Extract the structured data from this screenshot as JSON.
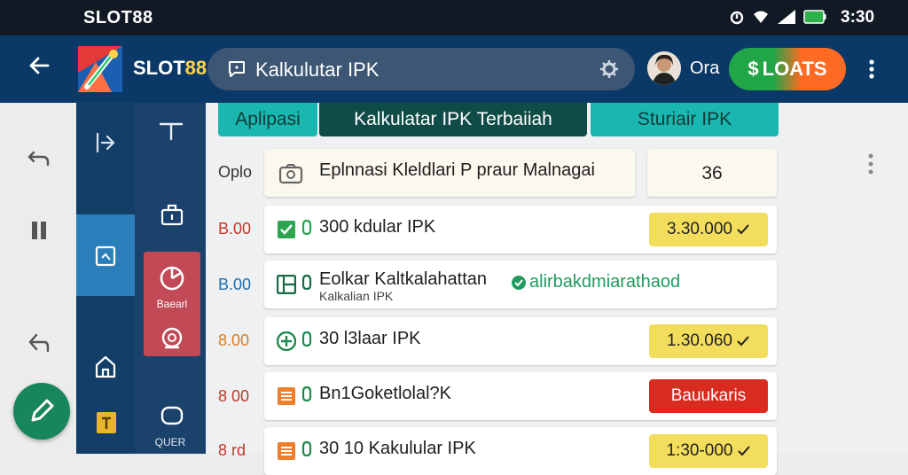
{
  "status_bar": {
    "brand": "SLOT88",
    "time": "3:30",
    "icons": [
      "alarm-icon",
      "wifi-icon",
      "signal-icon",
      "battery-icon"
    ]
  },
  "app_bar": {
    "title_main": "SLOT",
    "title_accent": "88",
    "search_text": "Kalkulutar IPK",
    "user_name": "Ora",
    "action_label": "LOATS",
    "action_symbol": "$"
  },
  "left_rail": {
    "icons": [
      "undo-icon",
      "pause-icon",
      "reply-icon",
      "edit-icon"
    ]
  },
  "rail1": {
    "icons": [
      "collapse-icon",
      "image-icon",
      "home-icon",
      "info-icon"
    ]
  },
  "rail2": {
    "icons": [
      "text-icon",
      "briefcase-icon",
      "pie-icon",
      "camera-icon",
      "chat-icon"
    ],
    "active_label": "Baearl",
    "bottom_label": "QUER"
  },
  "tabs": [
    "Aplipasi",
    "Kalkulatar IPK Terbaiiah",
    "Sturiair IPK"
  ],
  "rows": [
    {
      "label": "Oplo",
      "label_color": "#333333",
      "icon": "camera-icon",
      "text": "Eplnnasi Kleldlari P praur Malnagai",
      "badge": "36",
      "badge_type": "plain"
    },
    {
      "label": "B.00",
      "label_color": "#c0392b",
      "icon": "check-icon",
      "text": "300 kdular IPK",
      "badge": "3.30.000",
      "badge_type": "yellow"
    },
    {
      "label": "B.00",
      "label_color": "#1a6fb3",
      "icon": "layout-icon",
      "text": "Eolkar Kaltkalahattan",
      "subtext": "Kalkalian IPK",
      "inline_link": "alirbakdmiarathaod",
      "badge_type": "none"
    },
    {
      "label": "8.00",
      "label_color": "#e07b1a",
      "icon": "plus-icon",
      "text": "30 l3laar IPK",
      "badge": "1.30.060",
      "badge_type": "yellow"
    },
    {
      "label": "8 00",
      "label_color": "#c0392b",
      "icon": "list-icon",
      "text": "Bn1Goketlolal?K",
      "badge": "Bauukaris",
      "badge_type": "red"
    },
    {
      "label": "8 rd",
      "label_color": "#c0392b",
      "icon": "list-icon",
      "text": "30 10 Kakulular IPK",
      "badge": "1:30-000",
      "badge_type": "yellow"
    }
  ],
  "colors": {
    "appbar": "#0b3967",
    "rail_dark": "#123e68",
    "rail_active": "#2a7fba",
    "rail_highlight": "#c24a57",
    "tab_teal": "#19b7b0",
    "tab_dark": "#0f4b47",
    "fab_green": "#17865a"
  }
}
